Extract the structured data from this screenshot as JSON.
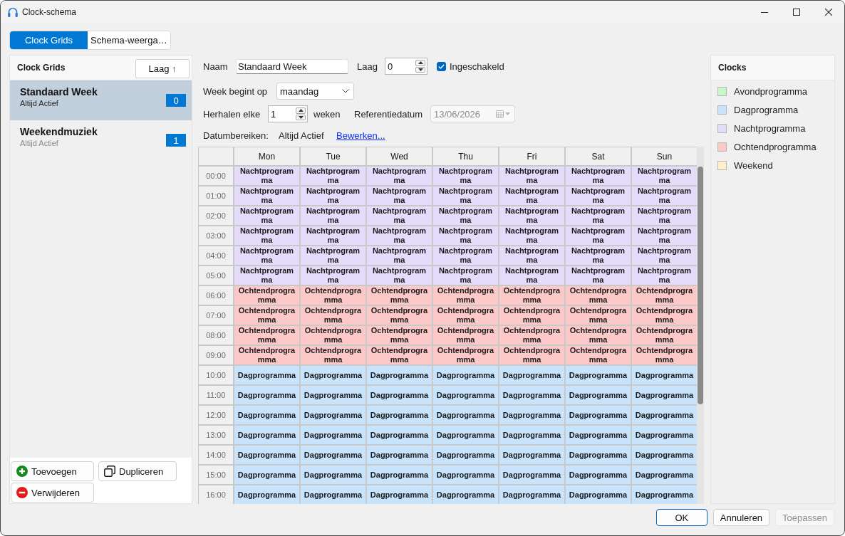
{
  "window": {
    "title": "Clock-schema"
  },
  "tabs": [
    {
      "label": "Clock Grids",
      "selected": true
    },
    {
      "label": "Schema-weerga…",
      "selected": false
    }
  ],
  "clock_grids": {
    "title": "Clock Grids",
    "sort_button": "Laag ↑",
    "items": [
      {
        "name": "Standaard Week",
        "subtitle": "Altijd Actief",
        "badge": "0",
        "selected": true
      },
      {
        "name": "Weekendmuziek",
        "subtitle": "Altijd Actief",
        "badge": "1",
        "selected": false
      }
    ],
    "buttons": [
      {
        "kind": "add",
        "label": "Toevoegen"
      },
      {
        "kind": "duplicate",
        "label": "Dupliceren"
      },
      {
        "kind": "remove",
        "label": "Verwijderen"
      }
    ]
  },
  "form": {
    "name": {
      "label": "Naam",
      "value": "Standaard Week"
    },
    "layer": {
      "label": "Laag",
      "value": "0"
    },
    "enabled": {
      "label": "Ingeschakeld",
      "checked": true
    },
    "week_start": {
      "label": "Week begint op",
      "value": "maandag"
    },
    "repeat": {
      "label": "Herhalen elke",
      "value": "1",
      "unit": "weken"
    },
    "reference_date": {
      "label": "Referentiedatum",
      "value": "13/06/2026",
      "disabled": true
    },
    "date_ranges": {
      "label": "Datumbereiken:",
      "value": "Altijd Actief",
      "link": "Bewerken..."
    }
  },
  "schedule": {
    "columns": [
      "Mon",
      "Tue",
      "Wed",
      "Thu",
      "Fri",
      "Sat",
      "Sun"
    ],
    "rows": [
      {
        "time": "00:00",
        "cells": [
          {
            "text": "Nachtprogramma",
            "color": "#e5dcfc"
          },
          {
            "text": "Nachtprogramma",
            "color": "#e5dcfc"
          },
          {
            "text": "Nachtprogramma",
            "color": "#e5dcfc"
          },
          {
            "text": "Nachtprogramma",
            "color": "#e5dcfc"
          },
          {
            "text": "Nachtprogramma",
            "color": "#e5dcfc"
          },
          {
            "text": "Nachtprogramma",
            "color": "#e5dcfc"
          },
          {
            "text": "Nachtprogramma",
            "color": "#e5dcfc"
          }
        ]
      },
      {
        "time": "01:00",
        "cells": [
          {
            "text": "Nachtprogramma",
            "color": "#e5dcfc"
          },
          {
            "text": "Nachtprogramma",
            "color": "#e5dcfc"
          },
          {
            "text": "Nachtprogramma",
            "color": "#e5dcfc"
          },
          {
            "text": "Nachtprogramma",
            "color": "#e5dcfc"
          },
          {
            "text": "Nachtprogramma",
            "color": "#e5dcfc"
          },
          {
            "text": "Nachtprogramma",
            "color": "#e5dcfc"
          },
          {
            "text": "Nachtprogramma",
            "color": "#e5dcfc"
          }
        ]
      },
      {
        "time": "02:00",
        "cells": [
          {
            "text": "Nachtprogramma",
            "color": "#e5dcfc"
          },
          {
            "text": "Nachtprogramma",
            "color": "#e5dcfc"
          },
          {
            "text": "Nachtprogramma",
            "color": "#e5dcfc"
          },
          {
            "text": "Nachtprogramma",
            "color": "#e5dcfc"
          },
          {
            "text": "Nachtprogramma",
            "color": "#e5dcfc"
          },
          {
            "text": "Nachtprogramma",
            "color": "#e5dcfc"
          },
          {
            "text": "Nachtprogramma",
            "color": "#e5dcfc"
          }
        ]
      },
      {
        "time": "03:00",
        "cells": [
          {
            "text": "Nachtprogramma",
            "color": "#e5dcfc"
          },
          {
            "text": "Nachtprogramma",
            "color": "#e5dcfc"
          },
          {
            "text": "Nachtprogramma",
            "color": "#e5dcfc"
          },
          {
            "text": "Nachtprogramma",
            "color": "#e5dcfc"
          },
          {
            "text": "Nachtprogramma",
            "color": "#e5dcfc"
          },
          {
            "text": "Nachtprogramma",
            "color": "#e5dcfc"
          },
          {
            "text": "Nachtprogramma",
            "color": "#e5dcfc"
          }
        ]
      },
      {
        "time": "04:00",
        "cells": [
          {
            "text": "Nachtprogramma",
            "color": "#e5dcfc"
          },
          {
            "text": "Nachtprogramma",
            "color": "#e5dcfc"
          },
          {
            "text": "Nachtprogramma",
            "color": "#e5dcfc"
          },
          {
            "text": "Nachtprogramma",
            "color": "#e5dcfc"
          },
          {
            "text": "Nachtprogramma",
            "color": "#e5dcfc"
          },
          {
            "text": "Nachtprogramma",
            "color": "#e5dcfc"
          },
          {
            "text": "Nachtprogramma",
            "color": "#e5dcfc"
          }
        ]
      },
      {
        "time": "05:00",
        "cells": [
          {
            "text": "Nachtprogramma",
            "color": "#e5dcfc"
          },
          {
            "text": "Nachtprogramma",
            "color": "#e5dcfc"
          },
          {
            "text": "Nachtprogramma",
            "color": "#e5dcfc"
          },
          {
            "text": "Nachtprogramma",
            "color": "#e5dcfc"
          },
          {
            "text": "Nachtprogramma",
            "color": "#e5dcfc"
          },
          {
            "text": "Nachtprogramma",
            "color": "#e5dcfc"
          },
          {
            "text": "Nachtprogramma",
            "color": "#e5dcfc"
          }
        ]
      },
      {
        "time": "06:00",
        "cells": [
          {
            "text": "Ochtendprogramma",
            "color": "#fcc8c8"
          },
          {
            "text": "Ochtendprogramma",
            "color": "#fcc8c8"
          },
          {
            "text": "Ochtendprogramma",
            "color": "#fcc8c8"
          },
          {
            "text": "Ochtendprogramma",
            "color": "#fcc8c8"
          },
          {
            "text": "Ochtendprogramma",
            "color": "#fcc8c8"
          },
          {
            "text": "Ochtendprogramma",
            "color": "#fcc8c8"
          },
          {
            "text": "Ochtendprogramma",
            "color": "#fcc8c8"
          }
        ]
      },
      {
        "time": "07:00",
        "cells": [
          {
            "text": "Ochtendprogramma",
            "color": "#fcc8c8"
          },
          {
            "text": "Ochtendprogramma",
            "color": "#fcc8c8"
          },
          {
            "text": "Ochtendprogramma",
            "color": "#fcc8c8"
          },
          {
            "text": "Ochtendprogramma",
            "color": "#fcc8c8"
          },
          {
            "text": "Ochtendprogramma",
            "color": "#fcc8c8"
          },
          {
            "text": "Ochtendprogramma",
            "color": "#fcc8c8"
          },
          {
            "text": "Ochtendprogramma",
            "color": "#fcc8c8"
          }
        ]
      },
      {
        "time": "08:00",
        "cells": [
          {
            "text": "Ochtendprogramma",
            "color": "#fcc8c8"
          },
          {
            "text": "Ochtendprogramma",
            "color": "#fcc8c8"
          },
          {
            "text": "Ochtendprogramma",
            "color": "#fcc8c8"
          },
          {
            "text": "Ochtendprogramma",
            "color": "#fcc8c8"
          },
          {
            "text": "Ochtendprogramma",
            "color": "#fcc8c8"
          },
          {
            "text": "Ochtendprogramma",
            "color": "#fcc8c8"
          },
          {
            "text": "Ochtendprogramma",
            "color": "#fcc8c8"
          }
        ]
      },
      {
        "time": "09:00",
        "cells": [
          {
            "text": "Ochtendprogramma",
            "color": "#fcc8c8"
          },
          {
            "text": "Ochtendprogramma",
            "color": "#fcc8c8"
          },
          {
            "text": "Ochtendprogramma",
            "color": "#fcc8c8"
          },
          {
            "text": "Ochtendprogramma",
            "color": "#fcc8c8"
          },
          {
            "text": "Ochtendprogramma",
            "color": "#fcc8c8"
          },
          {
            "text": "Ochtendprogramma",
            "color": "#fcc8c8"
          },
          {
            "text": "Ochtendprogramma",
            "color": "#fcc8c8"
          }
        ]
      },
      {
        "time": "10:00",
        "cells": [
          {
            "text": "Dagprogramma",
            "color": "#c8e4fc"
          },
          {
            "text": "Dagprogramma",
            "color": "#c8e4fc"
          },
          {
            "text": "Dagprogramma",
            "color": "#c8e4fc"
          },
          {
            "text": "Dagprogramma",
            "color": "#c8e4fc"
          },
          {
            "text": "Dagprogramma",
            "color": "#c8e4fc"
          },
          {
            "text": "Dagprogramma",
            "color": "#c8e4fc"
          },
          {
            "text": "Dagprogramma",
            "color": "#c8e4fc"
          }
        ]
      },
      {
        "time": "11:00",
        "cells": [
          {
            "text": "Dagprogramma",
            "color": "#c8e4fc"
          },
          {
            "text": "Dagprogramma",
            "color": "#c8e4fc"
          },
          {
            "text": "Dagprogramma",
            "color": "#c8e4fc"
          },
          {
            "text": "Dagprogramma",
            "color": "#c8e4fc"
          },
          {
            "text": "Dagprogramma",
            "color": "#c8e4fc"
          },
          {
            "text": "Dagprogramma",
            "color": "#c8e4fc"
          },
          {
            "text": "Dagprogramma",
            "color": "#c8e4fc"
          }
        ]
      },
      {
        "time": "12:00",
        "cells": [
          {
            "text": "Dagprogramma",
            "color": "#c8e4fc"
          },
          {
            "text": "Dagprogramma",
            "color": "#c8e4fc"
          },
          {
            "text": "Dagprogramma",
            "color": "#c8e4fc"
          },
          {
            "text": "Dagprogramma",
            "color": "#c8e4fc"
          },
          {
            "text": "Dagprogramma",
            "color": "#c8e4fc"
          },
          {
            "text": "Dagprogramma",
            "color": "#c8e4fc"
          },
          {
            "text": "Dagprogramma",
            "color": "#c8e4fc"
          }
        ]
      },
      {
        "time": "13:00",
        "cells": [
          {
            "text": "Dagprogramma",
            "color": "#c8e4fc"
          },
          {
            "text": "Dagprogramma",
            "color": "#c8e4fc"
          },
          {
            "text": "Dagprogramma",
            "color": "#c8e4fc"
          },
          {
            "text": "Dagprogramma",
            "color": "#c8e4fc"
          },
          {
            "text": "Dagprogramma",
            "color": "#c8e4fc"
          },
          {
            "text": "Dagprogramma",
            "color": "#c8e4fc"
          },
          {
            "text": "Dagprogramma",
            "color": "#c8e4fc"
          }
        ]
      },
      {
        "time": "14:00",
        "cells": [
          {
            "text": "Dagprogramma",
            "color": "#c8e4fc"
          },
          {
            "text": "Dagprogramma",
            "color": "#c8e4fc"
          },
          {
            "text": "Dagprogramma",
            "color": "#c8e4fc"
          },
          {
            "text": "Dagprogramma",
            "color": "#c8e4fc"
          },
          {
            "text": "Dagprogramma",
            "color": "#c8e4fc"
          },
          {
            "text": "Dagprogramma",
            "color": "#c8e4fc"
          },
          {
            "text": "Dagprogramma",
            "color": "#c8e4fc"
          }
        ]
      },
      {
        "time": "15:00",
        "cells": [
          {
            "text": "Dagprogramma",
            "color": "#c8e4fc"
          },
          {
            "text": "Dagprogramma",
            "color": "#c8e4fc"
          },
          {
            "text": "Dagprogramma",
            "color": "#c8e4fc"
          },
          {
            "text": "Dagprogramma",
            "color": "#c8e4fc"
          },
          {
            "text": "Dagprogramma",
            "color": "#c8e4fc"
          },
          {
            "text": "Dagprogramma",
            "color": "#c8e4fc"
          },
          {
            "text": "Dagprogramma",
            "color": "#c8e4fc"
          }
        ]
      },
      {
        "time": "16:00",
        "cells": [
          {
            "text": "Dagprogramma",
            "color": "#c8e4fc"
          },
          {
            "text": "Dagprogramma",
            "color": "#c8e4fc"
          },
          {
            "text": "Dagprogramma",
            "color": "#c8e4fc"
          },
          {
            "text": "Dagprogramma",
            "color": "#c8e4fc"
          },
          {
            "text": "Dagprogramma",
            "color": "#c8e4fc"
          },
          {
            "text": "Dagprogramma",
            "color": "#c8e4fc"
          },
          {
            "text": "Dagprogramma",
            "color": "#c8e4fc"
          }
        ]
      }
    ]
  },
  "clocks": {
    "title": "Clocks",
    "items": [
      {
        "name": "Avondprogramma",
        "color": "#c8f8c8"
      },
      {
        "name": "Dagprogramma",
        "color": "#c8e4fc"
      },
      {
        "name": "Nachtprogramma",
        "color": "#e5dcfc"
      },
      {
        "name": "Ochtendprogramma",
        "color": "#fcc8c8"
      },
      {
        "name": "Weekend",
        "color": "#fff0c8"
      }
    ]
  },
  "dialog_buttons": [
    {
      "label": "OK",
      "default": true,
      "disabled": false
    },
    {
      "label": "Annuleren",
      "default": false,
      "disabled": false
    },
    {
      "label": "Toepassen",
      "default": false,
      "disabled": true
    }
  ]
}
